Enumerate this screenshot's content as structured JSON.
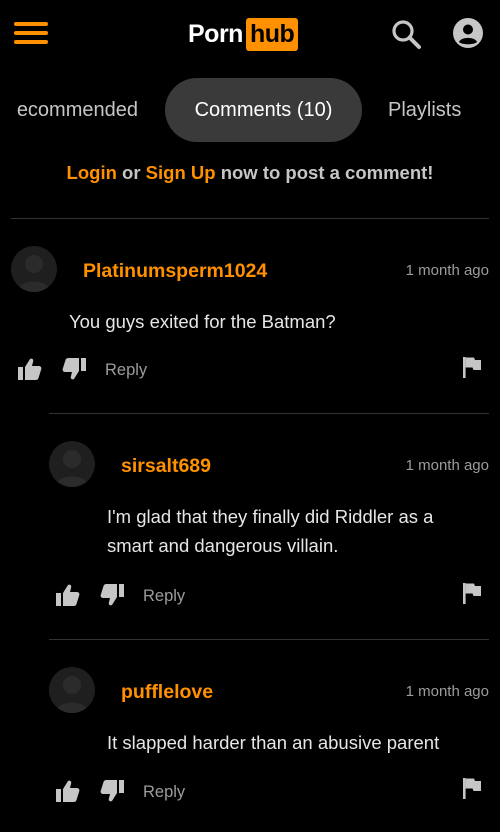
{
  "header": {
    "logo_left": "Porn",
    "logo_right": "hub",
    "menu_icon": "hamburger-menu-icon",
    "search_icon": "search-icon",
    "user_icon": "user-account-icon",
    "accent_color": "#ff9000"
  },
  "tabs": [
    {
      "label": "ecommended",
      "selected": false
    },
    {
      "label": "Comments (10)",
      "selected": true
    },
    {
      "label": "Playlists",
      "selected": false
    }
  ],
  "login_prompt": {
    "login_label": "Login",
    "or_text": " or ",
    "signup_label": "Sign Up",
    "rest_text": " now to post a comment!"
  },
  "comments": [
    {
      "username": "Platinumsperm1024",
      "time": "1 month ago",
      "body": "You guys exited for the Batman?",
      "reply_label": "Reply"
    },
    {
      "username": "sirsalt689",
      "time": "1 month ago",
      "body": "I'm glad that they finally did Riddler as a smart and dangerous villain.",
      "reply_label": "Reply"
    },
    {
      "username": "pufflelove",
      "time": "1 month ago",
      "body": "It slapped harder than an abusive parent",
      "reply_label": "Reply"
    }
  ]
}
